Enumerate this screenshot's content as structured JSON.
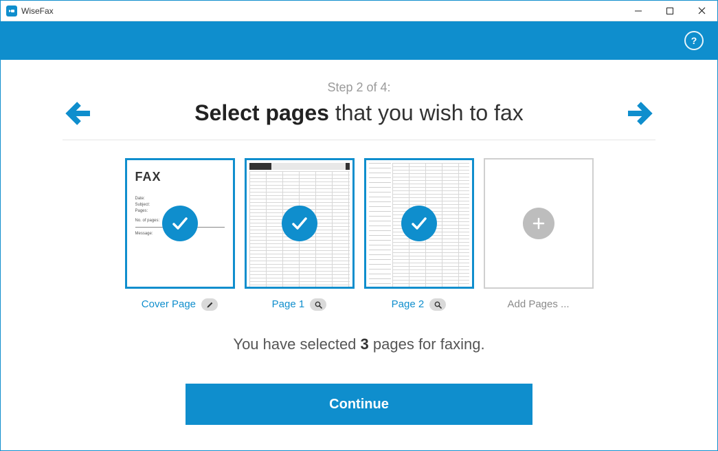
{
  "window": {
    "title": "WiseFax"
  },
  "header": {
    "help_label": "?"
  },
  "wizard": {
    "step_text": "Step 2 of 4:",
    "heading_bold": "Select pages",
    "heading_rest": " that you wish to fax"
  },
  "pages": {
    "cover": {
      "caption": "Cover Page",
      "thumb_title": "FAX"
    },
    "p1": {
      "caption": "Page 1"
    },
    "p2": {
      "caption": "Page 2"
    },
    "add": {
      "caption": "Add Pages ..."
    }
  },
  "summary": {
    "prefix": "You have selected ",
    "count": "3",
    "suffix": " pages for faxing."
  },
  "continue": {
    "label": "Continue"
  }
}
